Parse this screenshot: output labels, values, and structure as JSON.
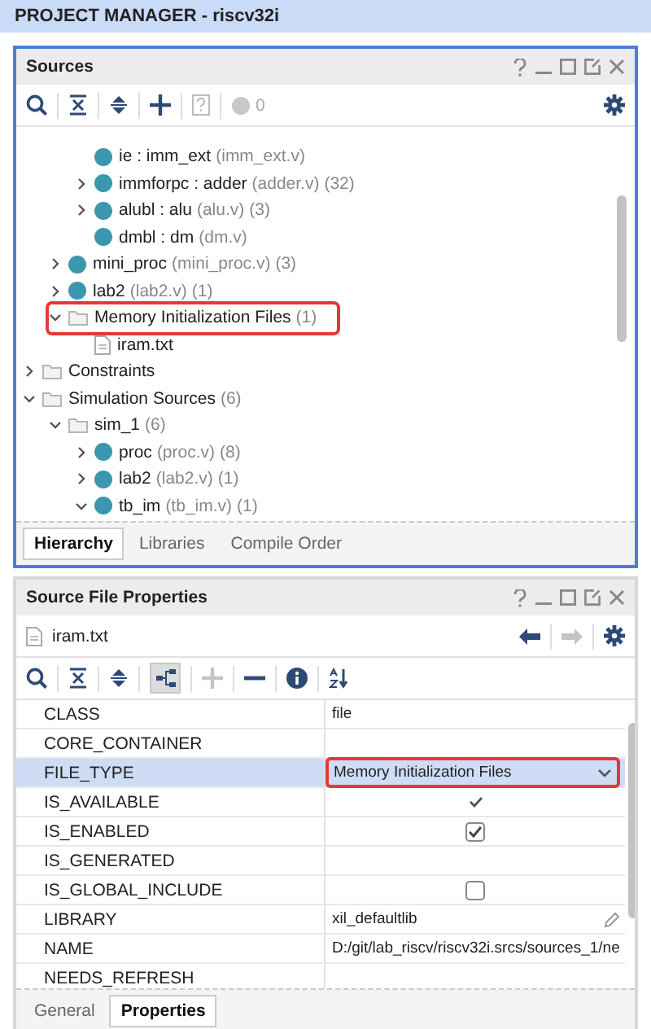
{
  "window": {
    "title": "PROJECT MANAGER - riscv32i"
  },
  "sources": {
    "title": "Sources",
    "status_count": "0",
    "tree": [
      {
        "children": [
          {
            "children": [
              {
                "kind": "module",
                "label": "ie : imm_ext",
                "file": "(imm_ext.v)"
              },
              {
                "kind": "module",
                "label": "immforpc : adder",
                "file": "(adder.v)",
                "count": "(32)",
                "expanded": false
              },
              {
                "kind": "module",
                "label": "alubl : alu",
                "file": "(alu.v)",
                "count": "(3)",
                "expanded": false
              },
              {
                "kind": "module",
                "label": "dmbl : dm",
                "file": "(dm.v)"
              }
            ]
          },
          {
            "kind": "module",
            "label": "mini_proc",
            "file": "(mini_proc.v)",
            "count": "(3)",
            "expanded": false
          },
          {
            "kind": "module",
            "label": "lab2",
            "file": "(lab2.v)",
            "count": "(1)",
            "expanded": false
          },
          {
            "kind": "folder",
            "label": "Memory Initialization Files",
            "count": "(1)",
            "expanded": true,
            "highlighted": true,
            "children": [
              {
                "kind": "file",
                "label": "iram.txt"
              }
            ]
          }
        ]
      },
      {
        "kind": "folder",
        "label": "Constraints",
        "expanded": false
      },
      {
        "kind": "folder",
        "label": "Simulation Sources",
        "count": "(6)",
        "expanded": true,
        "children": [
          {
            "kind": "folder",
            "label": "sim_1",
            "count": "(6)",
            "expanded": true,
            "children": [
              {
                "kind": "module",
                "label": "proc",
                "file": "(proc.v)",
                "count": "(8)",
                "expanded": false
              },
              {
                "kind": "module",
                "label": "lab2",
                "file": "(lab2.v)",
                "count": "(1)",
                "expanded": false
              },
              {
                "kind": "module",
                "label": "tb_im",
                "file": "(tb_im.v)",
                "count": "(1)",
                "expanded": true
              }
            ]
          }
        ]
      }
    ],
    "tabs": [
      {
        "label": "Hierarchy",
        "selected": true
      },
      {
        "label": "Libraries",
        "selected": false
      },
      {
        "label": "Compile Order",
        "selected": false
      }
    ]
  },
  "properties": {
    "title": "Source File Properties",
    "file": "iram.txt",
    "rows": [
      {
        "name": "CLASS",
        "kind": "text",
        "value": "file",
        "selected": false
      },
      {
        "name": "CORE_CONTAINER",
        "kind": "text",
        "selected": false
      },
      {
        "name": "FILE_TYPE",
        "kind": "dropdown",
        "value": "Memory Initialization Files",
        "selected": true,
        "highlighted": true
      },
      {
        "name": "IS_AVAILABLE",
        "kind": "tick",
        "checked": true,
        "selected": false
      },
      {
        "name": "IS_ENABLED",
        "kind": "checkbox",
        "checked": true,
        "selected": false
      },
      {
        "name": "IS_GENERATED",
        "kind": "tick",
        "checked": false,
        "selected": false
      },
      {
        "name": "IS_GLOBAL_INCLUDE",
        "kind": "checkbox",
        "checked": false,
        "selected": false
      },
      {
        "name": "LIBRARY",
        "kind": "editable",
        "value": "xil_defaultlib",
        "selected": false
      },
      {
        "name": "NAME",
        "kind": "text",
        "value": "D:/git/lab_riscv/riscv32i.srcs/sources_1/ne",
        "selected": false
      },
      {
        "name": "NEEDS_REFRESH",
        "kind": "text",
        "selected": false
      }
    ],
    "tabs": [
      {
        "label": "General",
        "selected": false
      },
      {
        "label": "Properties",
        "selected": true
      }
    ]
  }
}
